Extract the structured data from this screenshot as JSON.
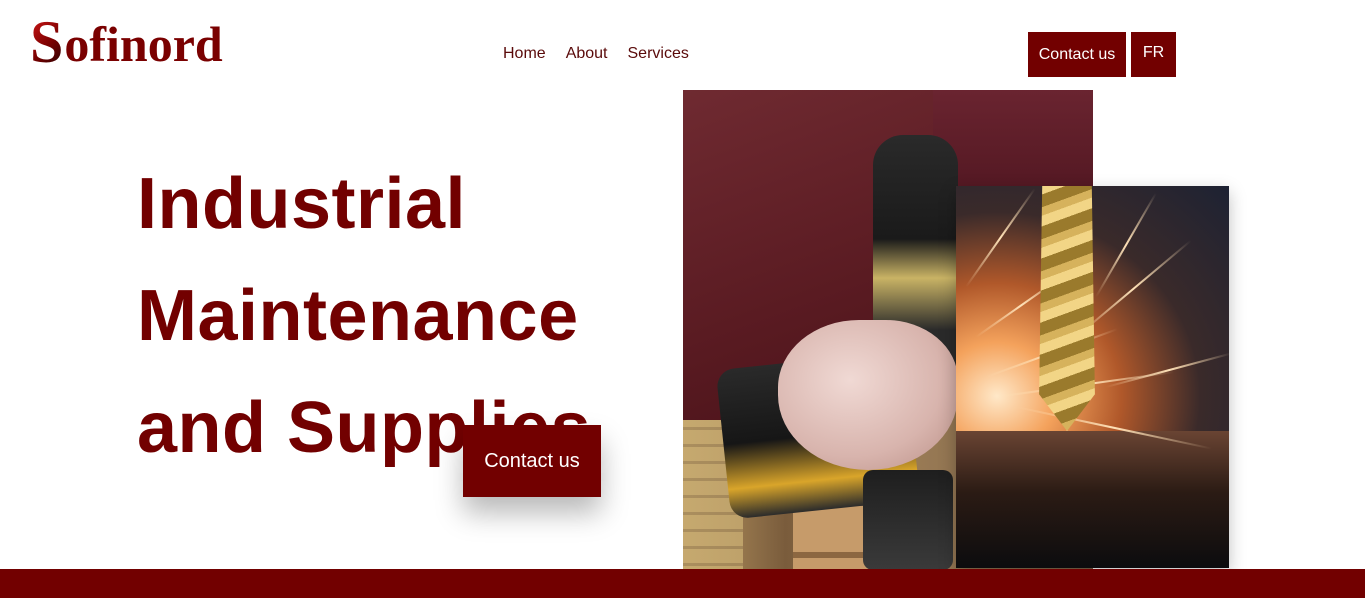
{
  "brand": {
    "logo_initial": "S",
    "logo_rest": "ofinord",
    "primary_color": "#720000"
  },
  "nav": {
    "items": [
      "Home",
      "About",
      "Services"
    ]
  },
  "header": {
    "contact_label": "Contact us",
    "language_label": "FR"
  },
  "hero": {
    "title_lines": [
      "Industrial",
      "Maintenance",
      "and Supplies"
    ],
    "cta_label": "Contact us"
  },
  "images": {
    "worker": "worker-with-cordless-drill-photo",
    "sparks": "drill-bit-sparks-photo"
  }
}
